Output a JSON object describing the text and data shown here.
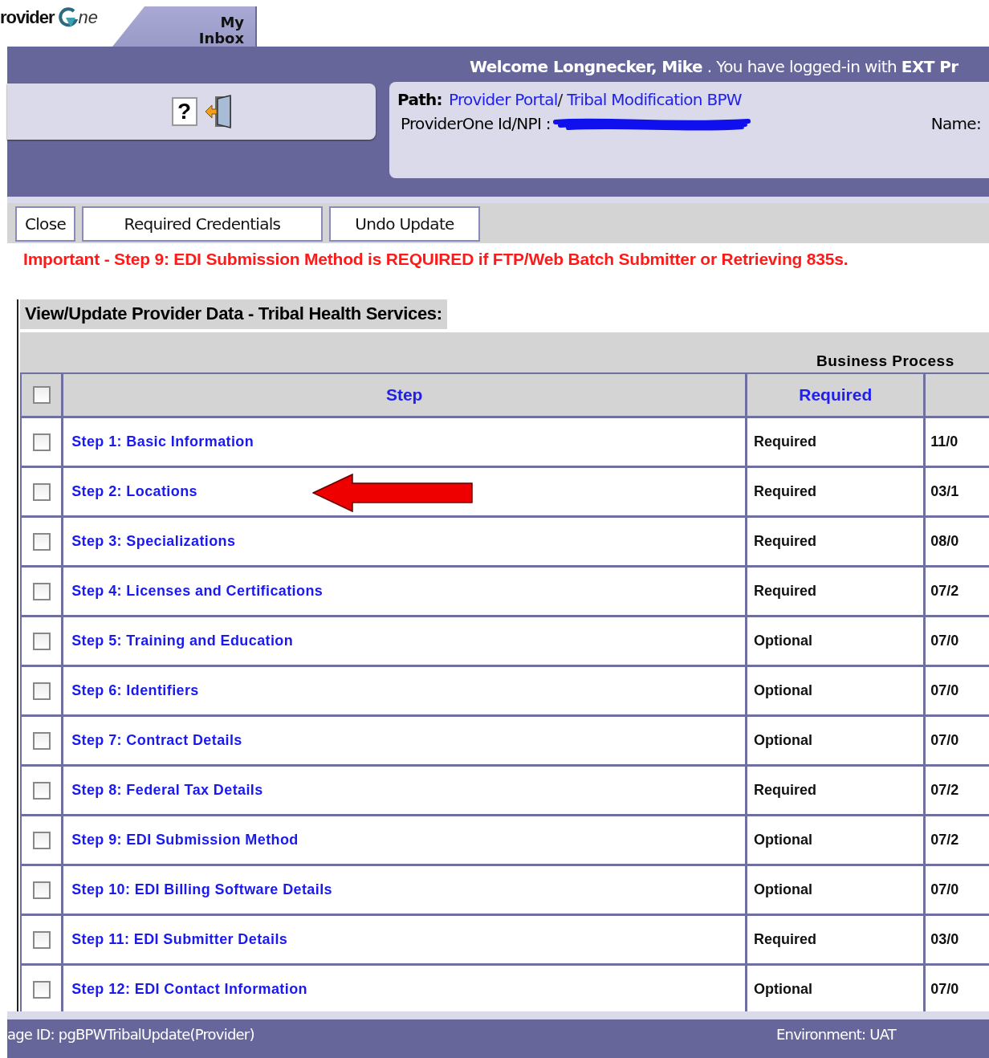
{
  "header": {
    "logo": {
      "text_left": "rovider",
      "text_right": "ne"
    },
    "tab": {
      "lines": [
        "My",
        "Inbox"
      ]
    },
    "help_glyph": "?",
    "welcome": "**Welcome Longnecker, Mike** . You have logged-in with **EXT Pr**"
  },
  "path": {
    "label": "Path:",
    "crumbs": [
      {
        "text": "Provider Portal",
        "kind": "link"
      },
      {
        "text": "/ ",
        "kind": "plain"
      },
      {
        "text": "Tribal Modification BPW",
        "kind": "link"
      }
    ],
    "id_label": "ProviderOne Id/NPI :",
    "name_label": "Name:"
  },
  "toolbar": {
    "buttons": [
      "Close",
      "Required Credentials",
      "Undo Update"
    ]
  },
  "notice": "Important - Step 9: EDI Submission Method is REQUIRED if FTP/Web Batch Submitter or Retrieving 835s.",
  "section_title": "View/Update Provider Data - Tribal Health Services:",
  "table": {
    "group_header": "Business Process",
    "header": {
      "checked": false,
      "columns": [
        "Step",
        "Required"
      ]
    },
    "rows": [
      {
        "checked": false,
        "step": "Step 1: Basic Information",
        "required": "Required",
        "column_3": "11/0"
      },
      {
        "checked": false,
        "step": "Step 2: Locations",
        "required": "Required",
        "column_3": "03/1",
        "pointer": true
      },
      {
        "checked": false,
        "step": "Step 3: Specializations",
        "required": "Required",
        "column_3": "08/0"
      },
      {
        "checked": false,
        "step": "Step 4: Licenses and Certifications",
        "required": "Required",
        "column_3": "07/2"
      },
      {
        "checked": false,
        "step": "Step 5: Training and Education",
        "required": "Optional",
        "column_3": "07/0"
      },
      {
        "checked": false,
        "step": "Step 6: Identifiers",
        "required": "Optional",
        "column_3": "07/0"
      },
      {
        "checked": false,
        "step": "Step 7: Contract Details",
        "required": "Optional",
        "column_3": "07/0"
      },
      {
        "checked": false,
        "step": "Step 8: Federal Tax Details",
        "required": "Required",
        "column_3": "07/2"
      },
      {
        "checked": false,
        "step": "Step 9: EDI Submission Method",
        "required": "Optional",
        "column_3": "07/2"
      },
      {
        "checked": false,
        "step": "Step 10: EDI Billing Software Details",
        "required": "Optional",
        "column_3": "07/0"
      },
      {
        "checked": false,
        "step": "Step 11: EDI Submitter Details",
        "required": "Required",
        "column_3": "03/0"
      },
      {
        "checked": false,
        "step": "Step 12: EDI Contact Information",
        "required": "Optional",
        "column_3": "07/0"
      }
    ]
  },
  "footer": {
    "page_id": "age ID: pgBPWTribalUpdate(Provider)",
    "environment": "Environment: UAT"
  }
}
